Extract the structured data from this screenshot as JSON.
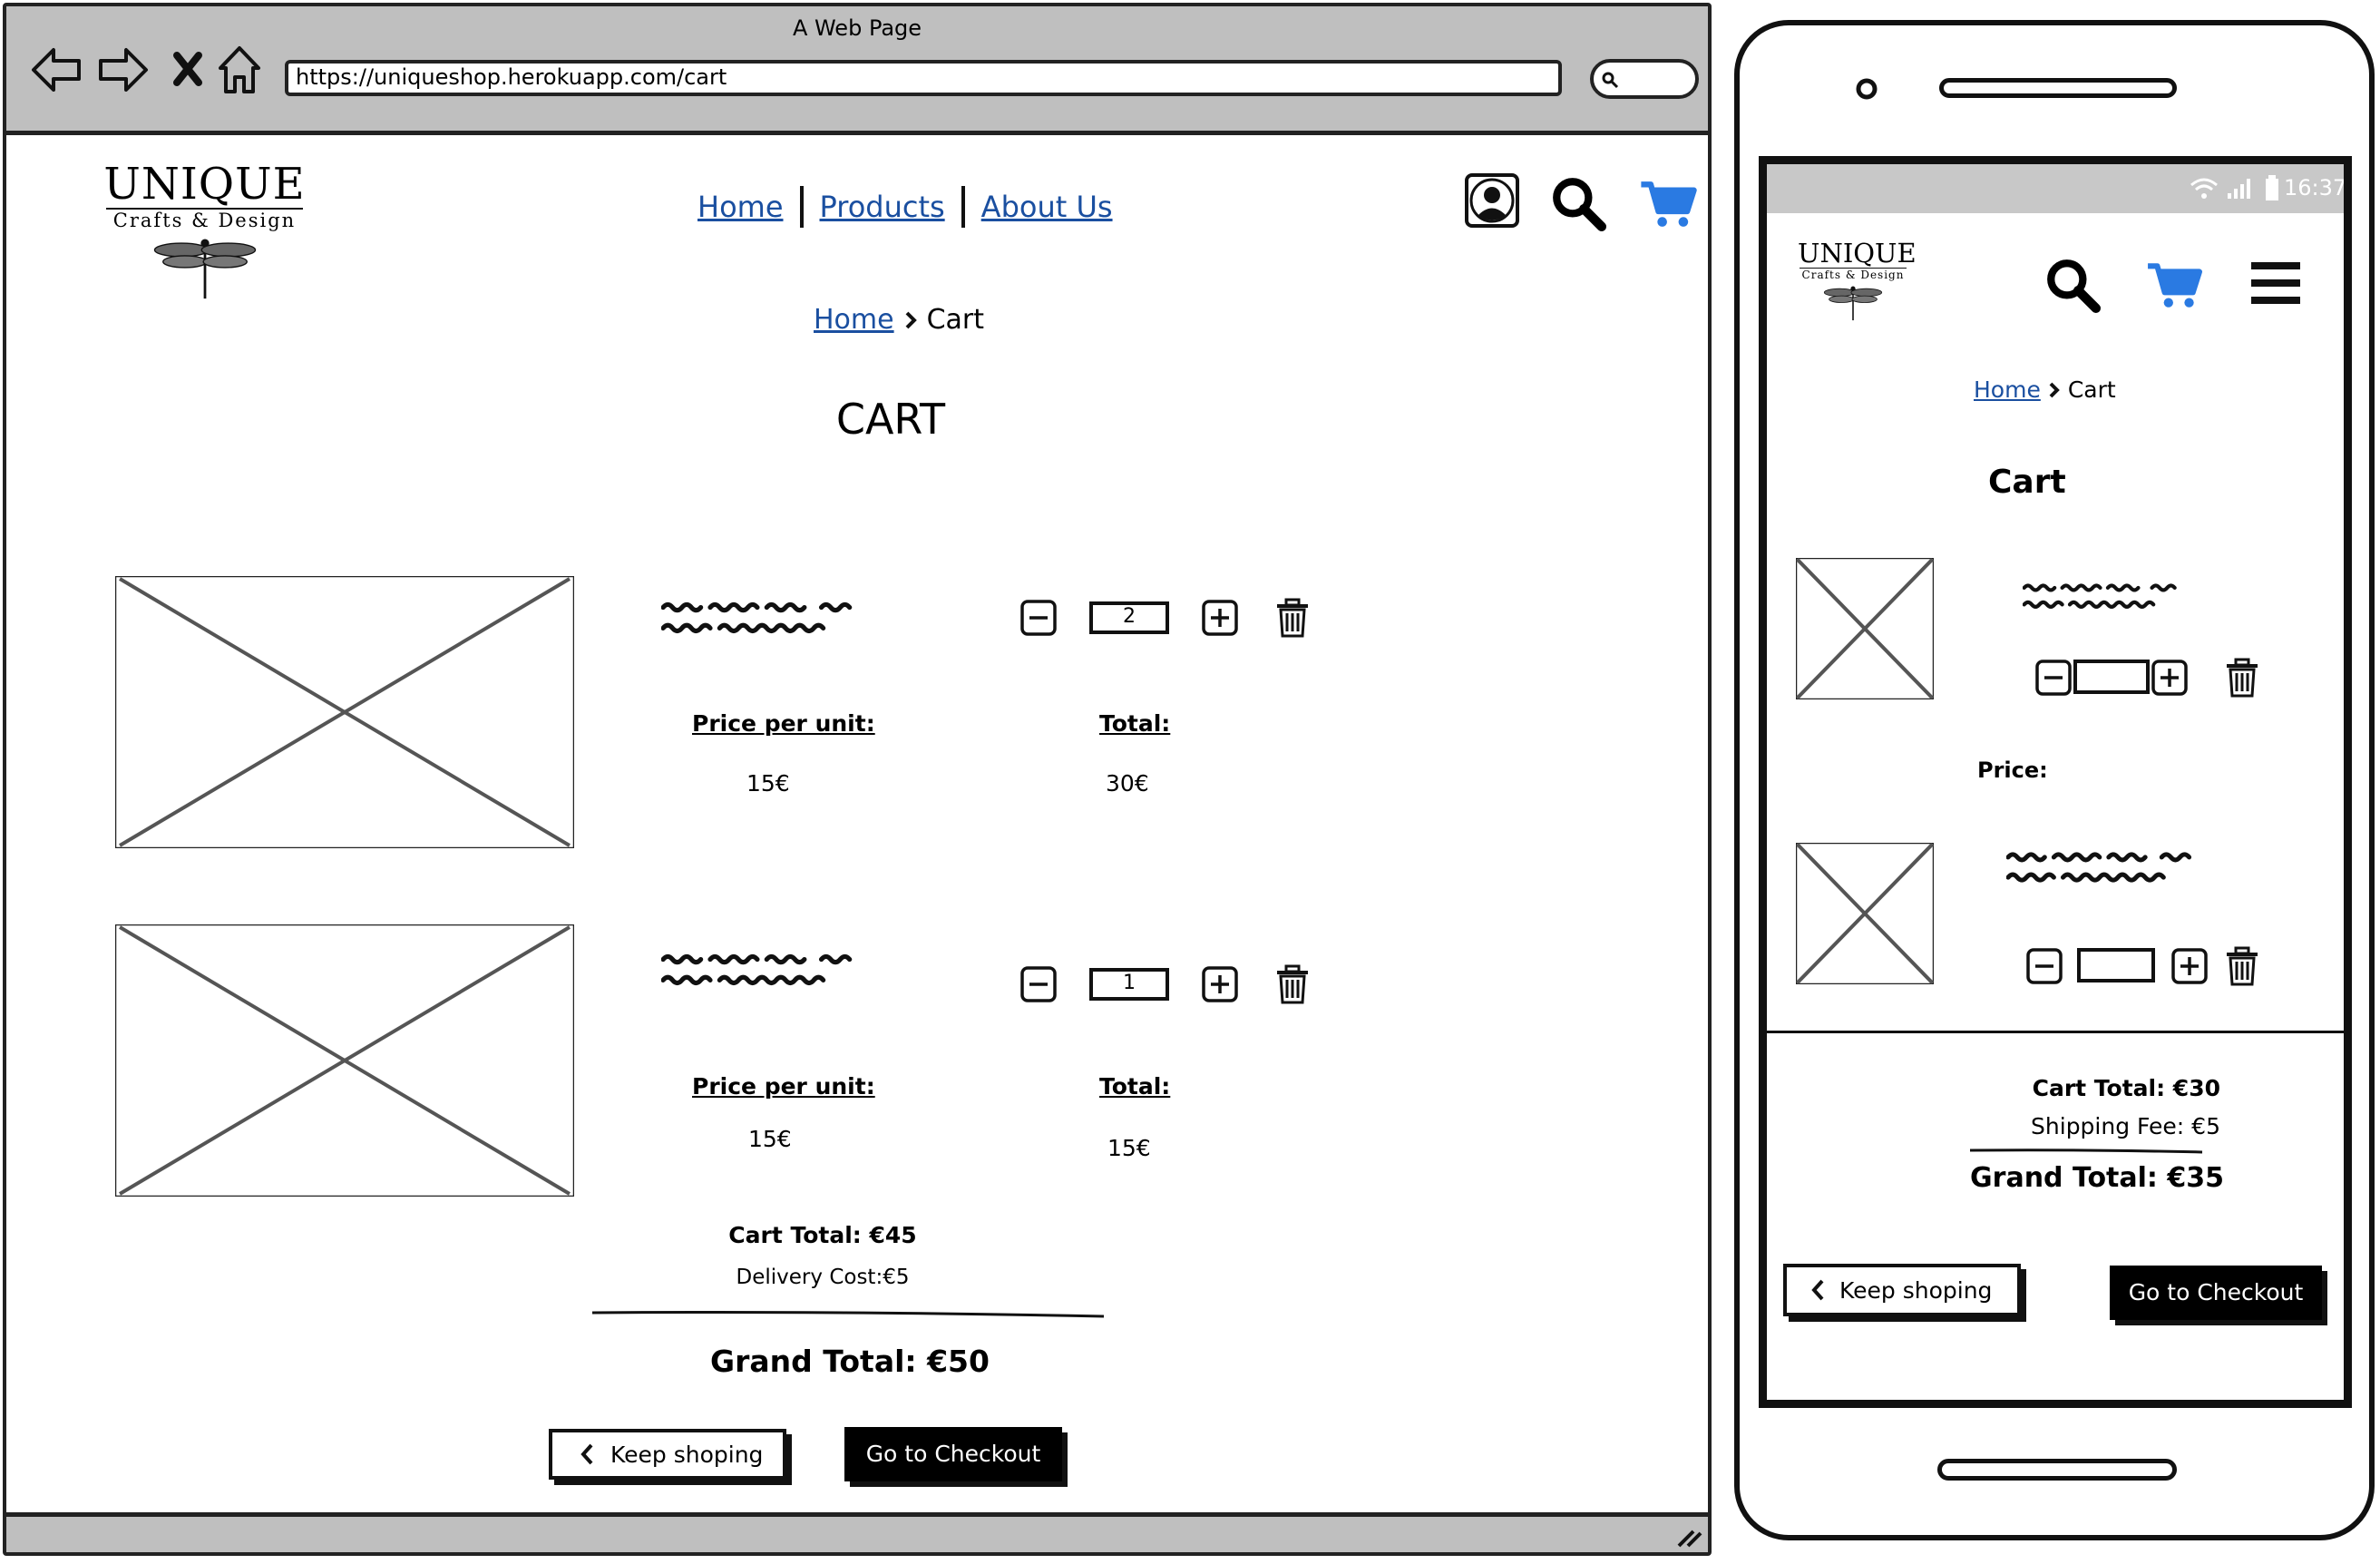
{
  "browser": {
    "window_title": "A Web Page",
    "url": "https://uniqueshop.herokuapp.com/cart"
  },
  "logo": {
    "line1": "UNIQUE",
    "line2": "Crafts & Design"
  },
  "nav": {
    "items": [
      {
        "label": "Home"
      },
      {
        "label": "Products"
      },
      {
        "label": "About Us"
      }
    ]
  },
  "breadcrumb": {
    "home": "Home",
    "current": "Cart"
  },
  "desktop": {
    "title": "CART",
    "items": [
      {
        "quantity": "2",
        "price_label": "Price per unit:",
        "price": "15€",
        "total_label": "Total:",
        "total": "30€"
      },
      {
        "quantity": "1",
        "price_label": "Price per unit:",
        "price": "15€",
        "total_label": "Total:",
        "total": "15€"
      }
    ],
    "cart_total": "Cart Total: €45",
    "delivery_cost": "Delivery Cost:€5",
    "grand_total": "Grand Total: €50",
    "keep_shopping": "Keep shoping",
    "checkout": "Go to Checkout"
  },
  "phone": {
    "status_time": "16:37",
    "title": "Cart",
    "price_label": "Price:",
    "cart_total": "Cart Total: €30",
    "shipping_fee": "Shipping Fee: €5",
    "grand_total": "Grand Total: €35",
    "keep_shopping": "Keep shoping",
    "checkout": "Go to Checkout"
  },
  "colors": {
    "accent_blue": "#2a7ae2",
    "link_blue": "#1a4fa0",
    "chrome_gray": "#bfbfbf"
  },
  "icons": [
    "back-arrow-icon",
    "forward-arrow-icon",
    "close-icon",
    "home-icon",
    "search-icon",
    "user-account-icon",
    "cart-icon",
    "menu-icon",
    "minus-icon",
    "plus-icon",
    "trash-icon",
    "chevron-left-icon",
    "dragonfly-logo-icon",
    "image-placeholder-icon",
    "wifi-icon",
    "signal-icon",
    "battery-icon"
  ]
}
